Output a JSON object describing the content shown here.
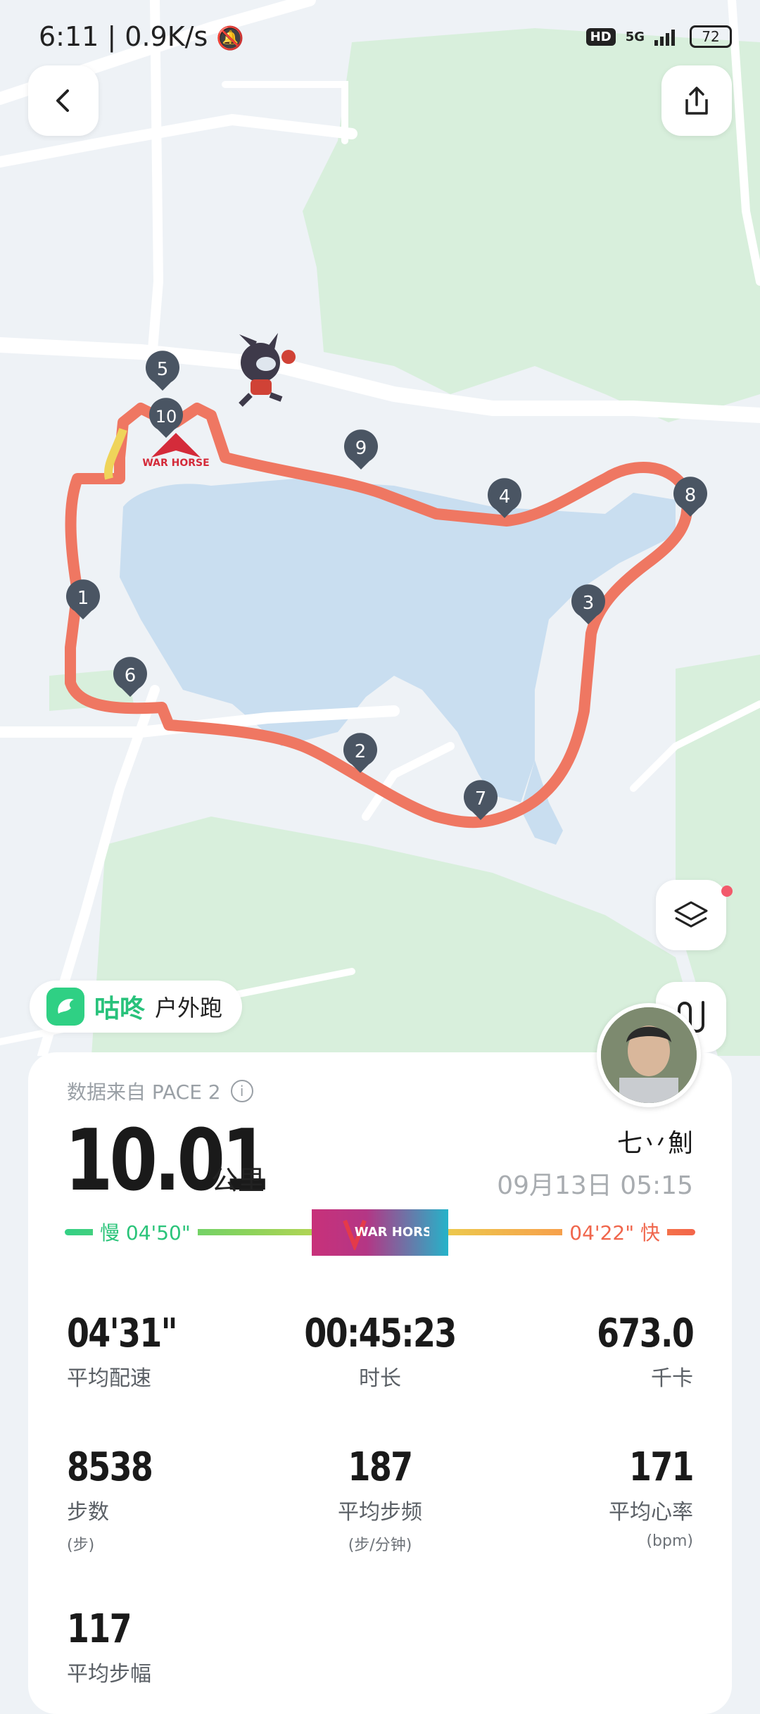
{
  "status_bar": {
    "time": "6:11 | 0.9K/s",
    "hd": "HD",
    "network": "5G",
    "battery": "72"
  },
  "source_chip": {
    "brand": "咕咚",
    "activity_type": "户外跑"
  },
  "summary": {
    "data_source": "数据来自 PACE 2",
    "distance": "10.01",
    "distance_unit": "公里",
    "username": "七丷魝",
    "datetime": "09月13日 05:15"
  },
  "pace_scale": {
    "slow": "慢 04'50\"",
    "fast": "04'22\" 快"
  },
  "stats": [
    {
      "value": "04'31\"",
      "label": "平均配速",
      "sub": ""
    },
    {
      "value": "00:45:23",
      "label": "时长",
      "sub": ""
    },
    {
      "value": "673.0",
      "label": "千卡",
      "sub": ""
    },
    {
      "value": "8538",
      "label": "步数",
      "sub": "(步)"
    },
    {
      "value": "187",
      "label": "平均步频",
      "sub": "(步/分钟)"
    },
    {
      "value": "171",
      "label": "平均心率",
      "sub": "(bpm)"
    },
    {
      "value": "117",
      "label": "平均步幅",
      "sub": ""
    }
  ],
  "map": {
    "km_markers": [
      "1",
      "2",
      "3",
      "4",
      "5",
      "6",
      "7",
      "8",
      "9",
      "10"
    ],
    "route_color": "#ef7762",
    "badge_text": "WAR HORSE"
  },
  "colors": {
    "accent_green": "#28c27b",
    "fast_red": "#f0664c",
    "water": "#c9def0",
    "park": "#d7eedd"
  }
}
